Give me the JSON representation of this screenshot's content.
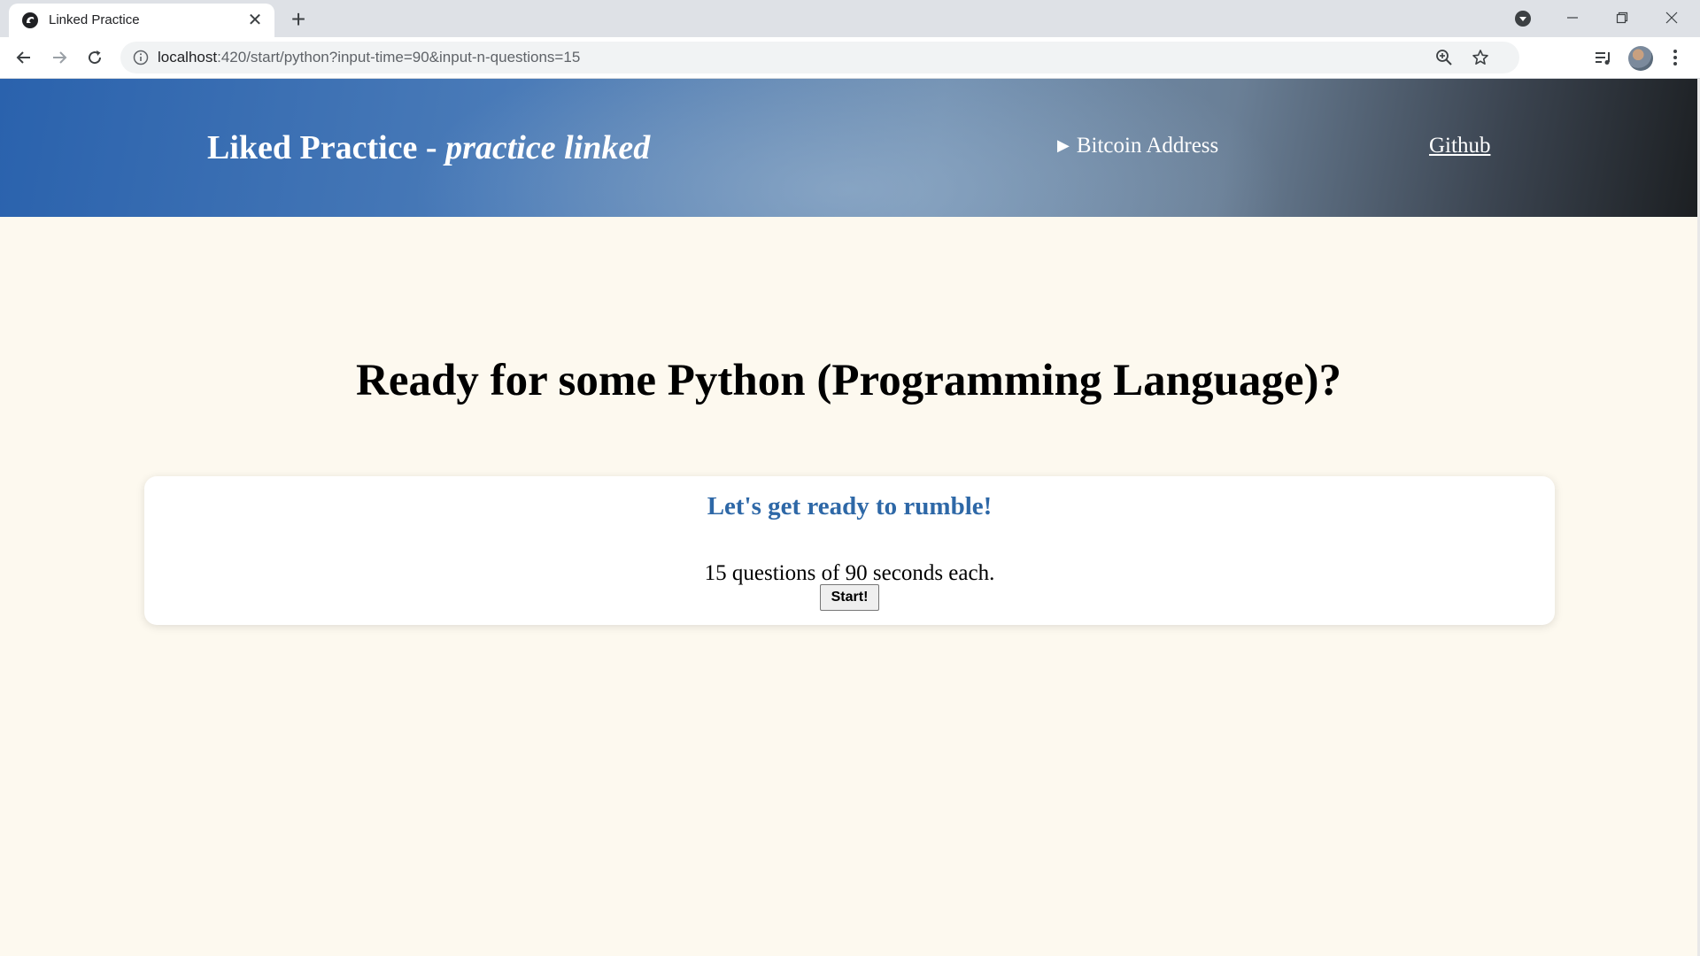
{
  "browser": {
    "tab_title": "Linked Practice",
    "url_host": "localhost",
    "url_rest": ":420/start/python?input-time=90&input-n-questions=15"
  },
  "header": {
    "brand_main": "Liked Practice - ",
    "brand_italic": "practice linked",
    "bitcoin_label": "Bitcoin Address",
    "github_label": "Github"
  },
  "main": {
    "heading": "Ready for some Python (Programming Language)?",
    "card": {
      "title": "Let's get ready to rumble!",
      "description": "15 questions of 90 seconds each.",
      "start_label": "Start!"
    }
  },
  "colors": {
    "page_bg": "#fdf9ef",
    "card_title": "#2e68a7",
    "header_start": "#2a62ad",
    "header_end": "#1c1f22"
  }
}
